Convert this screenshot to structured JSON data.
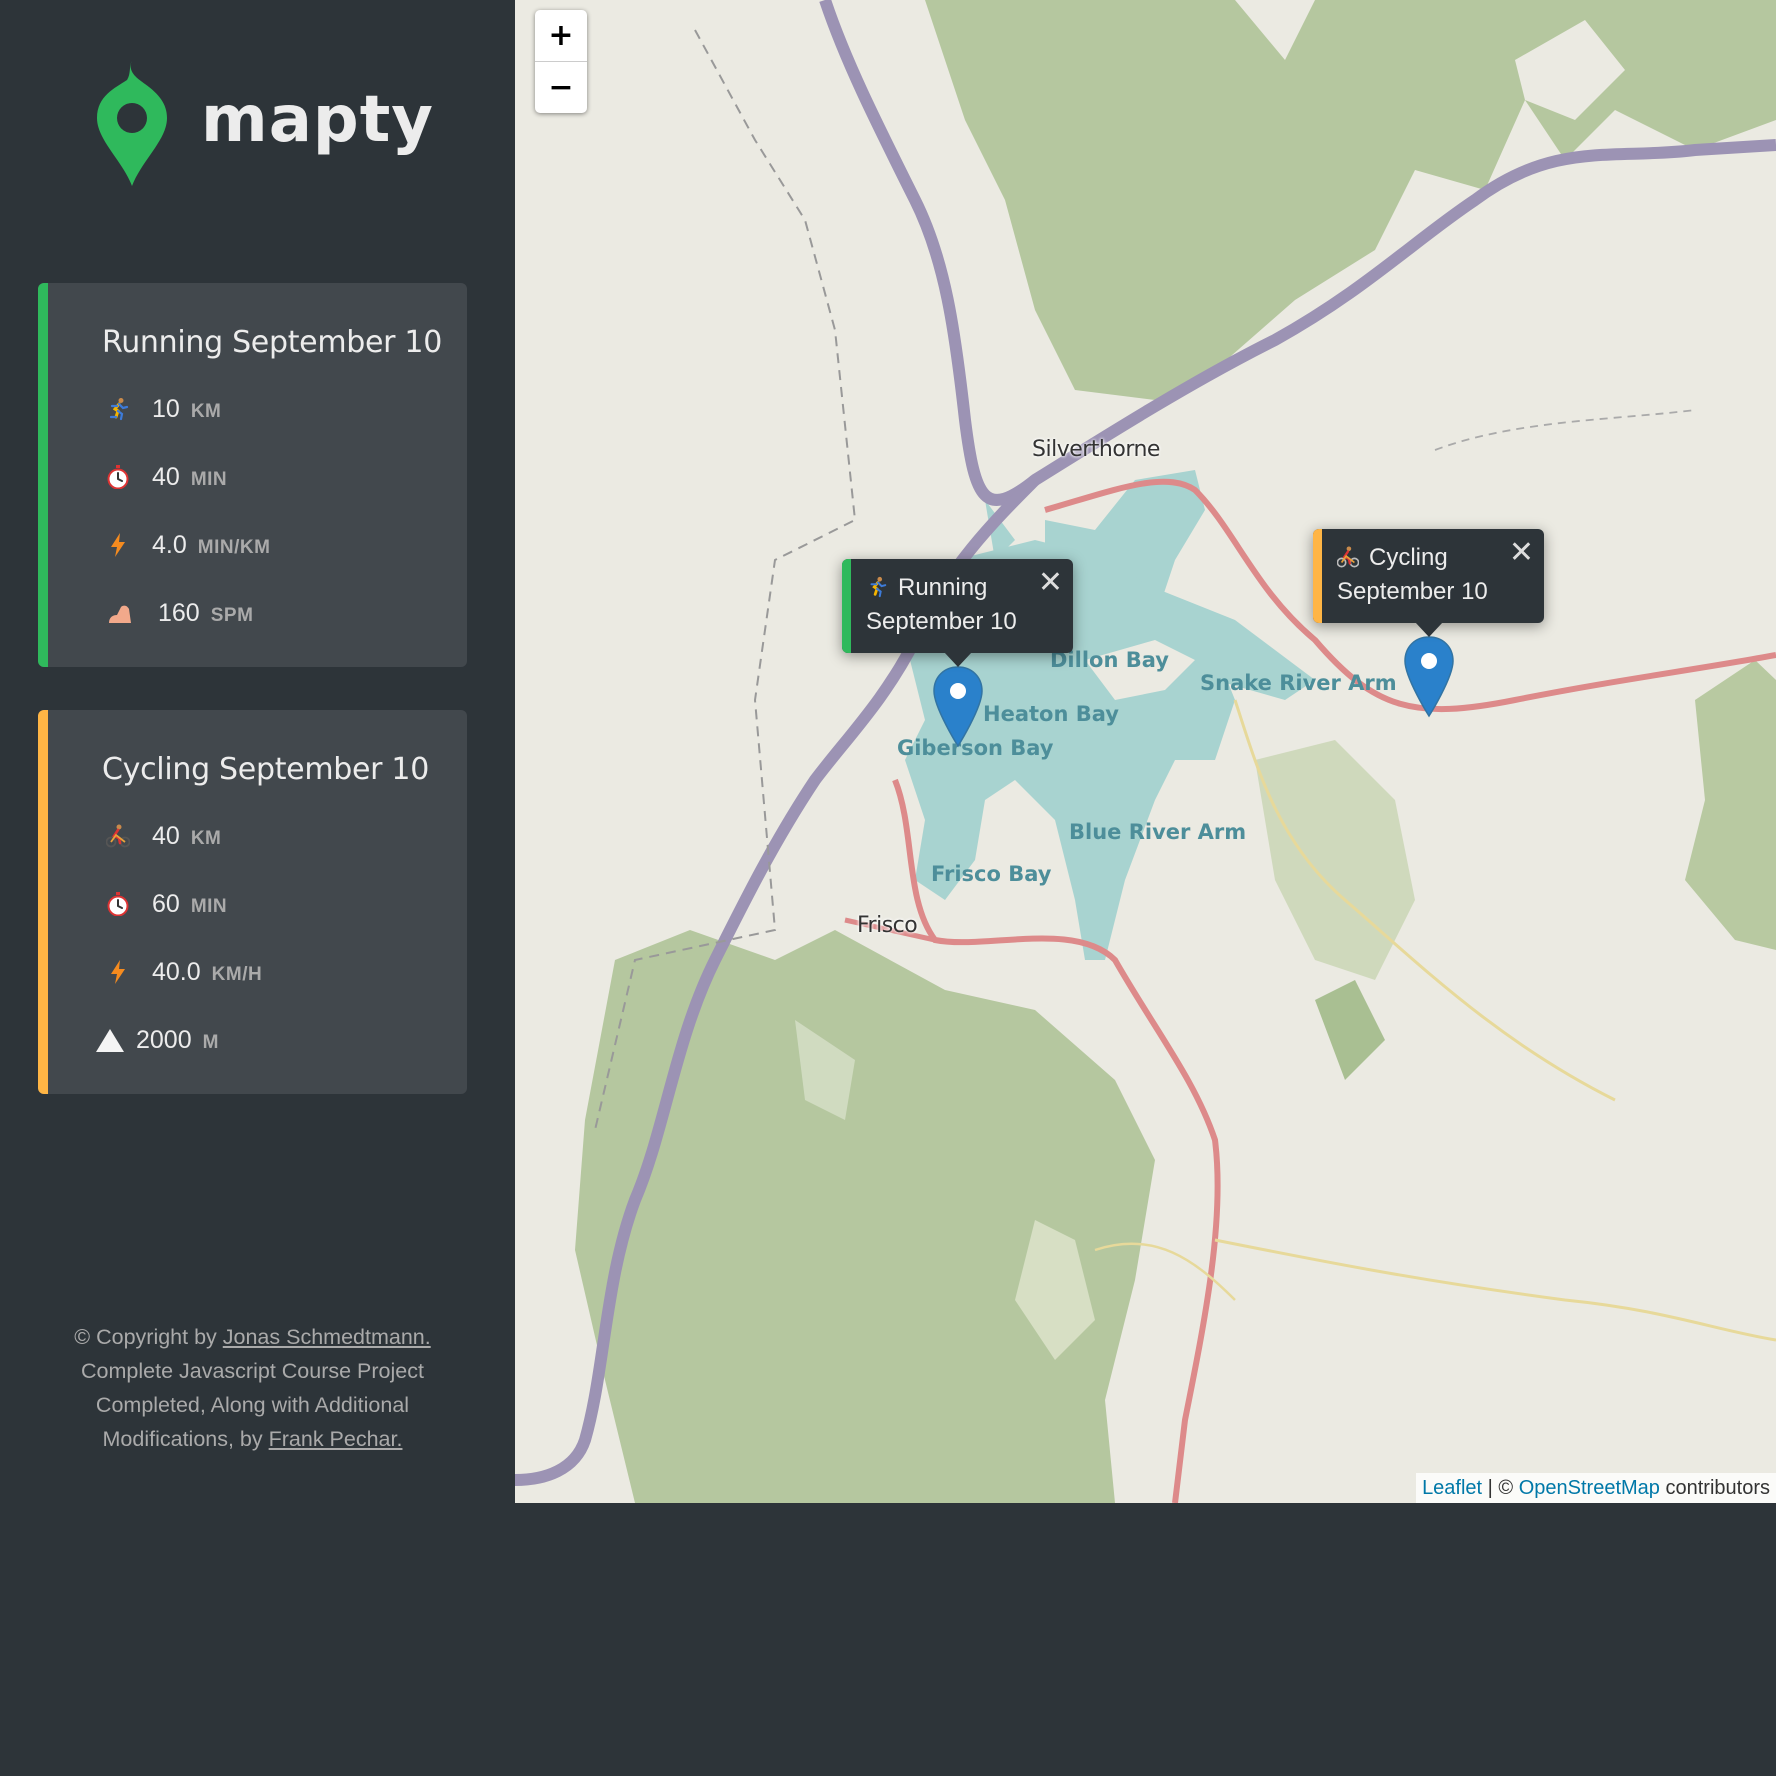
{
  "app": {
    "name": "mapty",
    "logo_icon": "map-pin-icon"
  },
  "colors": {
    "running": "#00c46a",
    "cycling": "#ffb545",
    "sidebar_bg": "#2d3439",
    "card_bg": "#42484d"
  },
  "workouts": [
    {
      "type": "running",
      "title": "Running September 10",
      "stats": [
        {
          "icon": "runner-icon",
          "value": "10",
          "unit": "KM"
        },
        {
          "icon": "stopwatch-icon",
          "value": "40",
          "unit": "MIN"
        },
        {
          "icon": "lightning-icon",
          "value": "4.0",
          "unit": "MIN/KM"
        },
        {
          "icon": "footprint-icon",
          "value": "160",
          "unit": "SPM"
        }
      ]
    },
    {
      "type": "cycling",
      "title": "Cycling September 10",
      "stats": [
        {
          "icon": "cyclist-icon",
          "value": "40",
          "unit": "KM"
        },
        {
          "icon": "stopwatch-icon",
          "value": "60",
          "unit": "MIN"
        },
        {
          "icon": "lightning-icon",
          "value": "40.0",
          "unit": "KM/H"
        },
        {
          "icon": "mountain-icon",
          "value": "2000",
          "unit": "M"
        }
      ]
    }
  ],
  "copyright": {
    "prefix": "© Copyright by ",
    "author_link": "Jonas Schmedtmann.",
    "middle": " Complete Javascript Course Project Completed, Along with Additional Modifications, by ",
    "contributor_link": "Frank Pechar."
  },
  "map": {
    "zoom_in": "+",
    "zoom_out": "−",
    "popups": [
      {
        "type": "running",
        "line1": "Running",
        "line2": "September 10",
        "close": "✕"
      },
      {
        "type": "cycling",
        "line1": "Cycling",
        "line2": "September 10",
        "close": "✕"
      }
    ],
    "labels": {
      "silverthorne": "Silverthorne",
      "frisco": "Frisco",
      "dillon_bay": "Dillon Bay",
      "heaton_bay": "Heaton Bay",
      "giberson_bay": "Giberson Bay",
      "frisco_bay": "Frisco Bay",
      "blue_river_arm": "Blue River Arm",
      "snake_river_arm": "Snake River Arm"
    },
    "attribution": {
      "leaflet": "Leaflet",
      "sep": " | © ",
      "osm": "OpenStreetMap",
      "suffix": " contributors"
    }
  }
}
